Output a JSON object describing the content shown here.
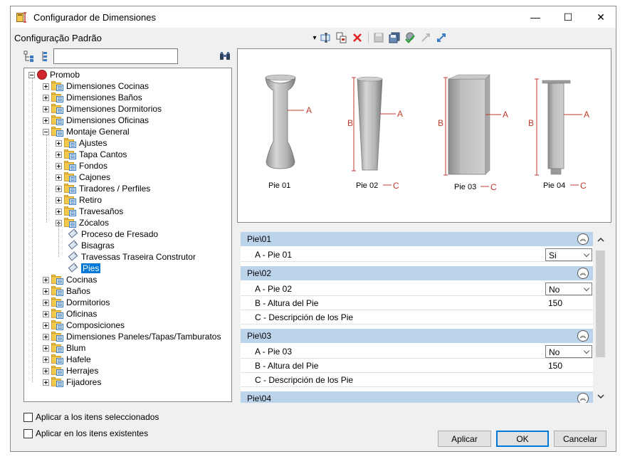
{
  "window": {
    "title": "Configurador de Dimensiones",
    "minimize_glyph": "—",
    "maximize_glyph": "☐",
    "close_glyph": "✕"
  },
  "toolbar": {
    "config_label": "Configuração Padrão",
    "dropdown_glyph": "▾",
    "icons": [
      "dropdown-arrow-icon",
      "rename-icon",
      "copy-icon",
      "delete-icon",
      "save-disabled-icon",
      "save-all-icon",
      "apply-check-icon",
      "expand-disabled-icon",
      "link-icon"
    ]
  },
  "tree": {
    "search_value": "",
    "root": "Promob",
    "level1_top": [
      "Dimensiones Cocinas",
      "Dimensiones Baños",
      "Dimensiones Dormitorios",
      "Dimensiones Oficinas",
      "Montaje General"
    ],
    "montaje_children_folders": [
      "Ajustes",
      "Tapa Cantos",
      "Fondos",
      "Cajones",
      "Tiradores / Perfiles",
      "Retiro",
      "Travesaños",
      "Zócalos"
    ],
    "montaje_children_items": [
      "Proceso de Fresado",
      "Bisagras",
      "Travessas Traseira Construtor",
      "Pies"
    ],
    "selected": "Pies",
    "level1_bottom": [
      "Cocinas",
      "Baños",
      "Dormitorios",
      "Oficinas",
      "Composiciones",
      "Dimensiones Paneles/Tapas/Tamburatos",
      "Blum",
      "Hafele",
      "Herrajes",
      "Fijadores"
    ]
  },
  "figure": {
    "labels": [
      "Pie 01",
      "Pie 02",
      "Pie 03",
      "Pie 04"
    ],
    "dim_a": "A",
    "dim_b": "B",
    "dim_c": "C",
    "accent_color": "#c0392b"
  },
  "properties": {
    "groups": [
      {
        "header": "Pie\\01",
        "rows": [
          {
            "name": "A - Pie 01",
            "value": "Si",
            "combo": true
          }
        ]
      },
      {
        "header": "Pie\\02",
        "rows": [
          {
            "name": "A - Pie 02",
            "value": "No",
            "combo": true
          },
          {
            "name": "B - Altura del Pie",
            "value": "150",
            "combo": false
          },
          {
            "name": "C - Descripción de los Pie",
            "value": "",
            "combo": false
          }
        ]
      },
      {
        "header": "Pie\\03",
        "rows": [
          {
            "name": "A - Pie 03",
            "value": "No",
            "combo": true
          },
          {
            "name": "B - Altura del Pie",
            "value": "150",
            "combo": false
          },
          {
            "name": "C - Descripción de los Pie",
            "value": "",
            "combo": false
          }
        ]
      },
      {
        "header": "Pie\\04",
        "rows": []
      }
    ],
    "collapse_glyph": "︽",
    "header_color": "#bcd3ec"
  },
  "options": {
    "apply_selected": "Aplicar a los itens seleccionados",
    "apply_existing": "Aplicar en los itens existentes"
  },
  "buttons": {
    "apply": "Aplicar",
    "ok": "OK",
    "cancel": "Cancelar"
  }
}
